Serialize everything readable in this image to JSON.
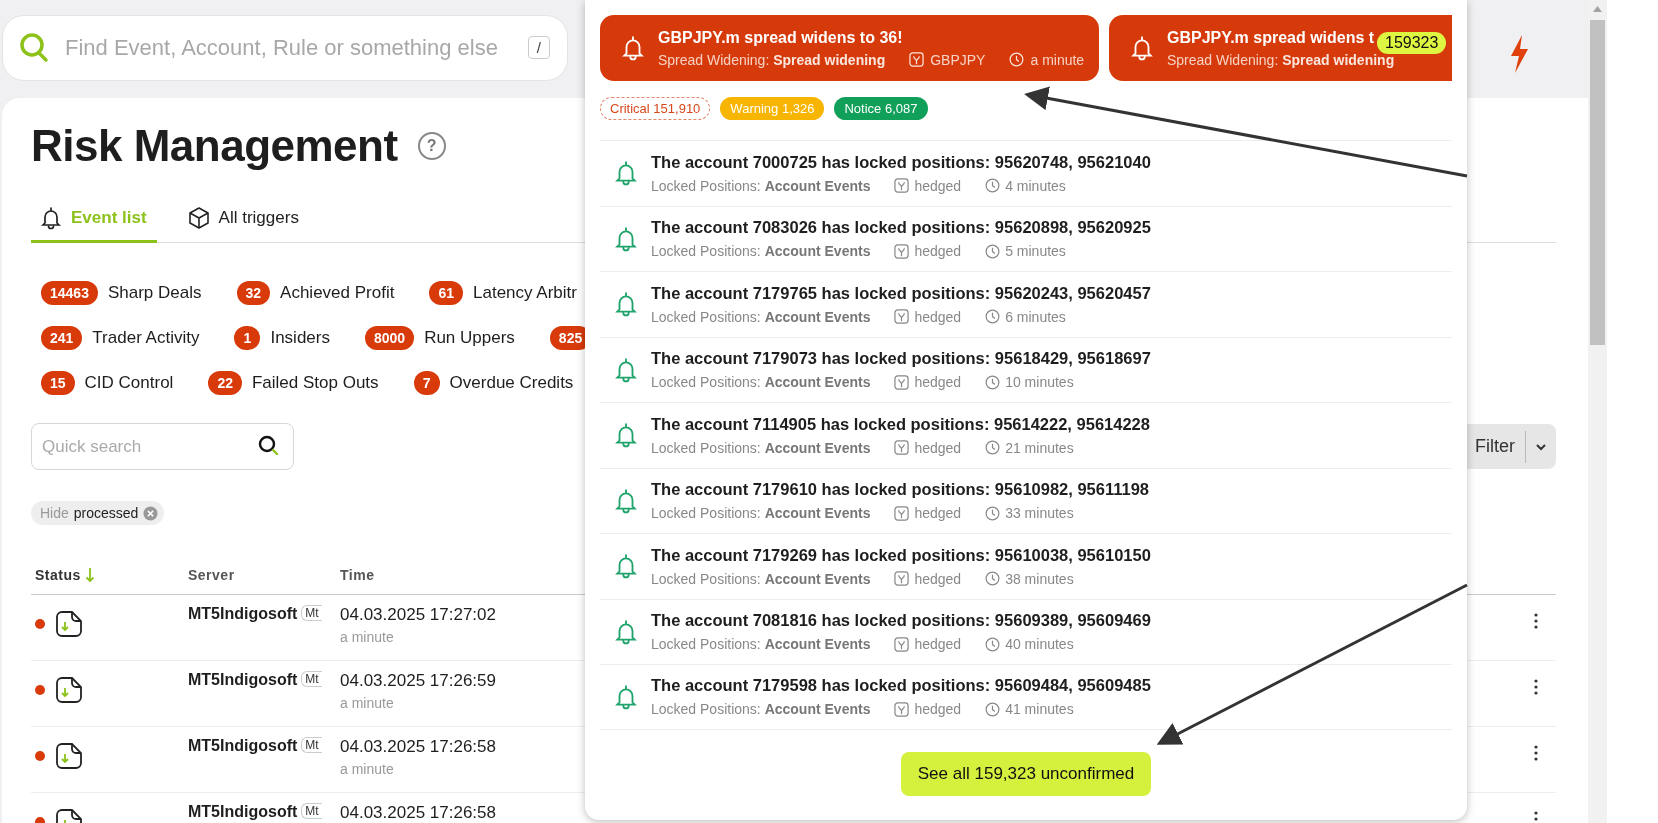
{
  "search": {
    "placeholder": "Find Event, Account, Rule or something else",
    "shortcut": "/"
  },
  "page": {
    "title": "Risk Management",
    "help": "?"
  },
  "tabs": [
    {
      "label": "Event list",
      "selected": true
    },
    {
      "label": "All triggers",
      "selected": false
    }
  ],
  "categories": [
    [
      {
        "count": "14463",
        "label": "Sharp Deals"
      },
      {
        "count": "32",
        "label": "Achieved Profit"
      },
      {
        "count": "61",
        "label": "Latency Arbitr"
      }
    ],
    [
      {
        "count": "241",
        "label": "Trader Activity"
      },
      {
        "count": "1",
        "label": "Insiders"
      },
      {
        "count": "8000",
        "label": "Run Uppers"
      },
      {
        "count": "825"
      }
    ],
    [
      {
        "count": "15",
        "label": "CID Control"
      },
      {
        "count": "22",
        "label": "Failed Stop Outs"
      },
      {
        "count": "7",
        "label": "Overdue Credits"
      }
    ]
  ],
  "quick_search": {
    "placeholder": "Quick search"
  },
  "filter_button": {
    "label": "Filter"
  },
  "active_filters": [
    {
      "label": "Hide",
      "value": "processed"
    }
  ],
  "table": {
    "columns": [
      {
        "label": "Status",
        "sorted": true
      },
      {
        "label": "Server",
        "sorted": false
      },
      {
        "label": "Time",
        "sorted": false
      }
    ],
    "rows": [
      {
        "color": "#d83a0a",
        "server": "MT5Indigosoft",
        "server_tag": "Mt",
        "time": "04.03.2025 17:27:02",
        "ago": "a minute"
      },
      {
        "color": "#d83a0a",
        "server": "MT5Indigosoft",
        "server_tag": "Mt",
        "time": "04.03.2025 17:26:59",
        "ago": "a minute"
      },
      {
        "color": "#d83a0a",
        "server": "MT5Indigosoft",
        "server_tag": "Mt",
        "time": "04.03.2025 17:26:58",
        "ago": "a minute"
      },
      {
        "color": "#d83a0a",
        "server": "MT5Indigosoft",
        "server_tag": "Mt",
        "time": "04.03.2025 17:26:58"
      }
    ]
  },
  "notifications": {
    "alerts": [
      {
        "title": "GBPJPY.m spread widens to 36!",
        "category": "Spread Widening:",
        "rule": "Spread widening",
        "symbol": "GBPJPY",
        "ago": "a minute"
      },
      {
        "title": "GBPJPY.m spread widens t",
        "category": "Spread Widening:",
        "rule": "Spread widening"
      }
    ],
    "unread_badge": "159323",
    "levels": [
      {
        "label": "Critical",
        "count": "151,910",
        "kind": "critical"
      },
      {
        "label": "Warning",
        "count": "1,326",
        "kind": "warning"
      },
      {
        "label": "Notice",
        "count": "6,087",
        "kind": "notice"
      }
    ],
    "events": [
      {
        "title": "The account 7000725 has locked positions: 95620748, 95621040",
        "category": "Locked Positions:",
        "group": "Account Events",
        "tag": "hedged",
        "ago": "4 minutes"
      },
      {
        "title": "The account 7083026 has locked positions: 95620898, 95620925",
        "category": "Locked Positions:",
        "group": "Account Events",
        "tag": "hedged",
        "ago": "5 minutes"
      },
      {
        "title": "The account 7179765 has locked positions: 95620243, 95620457",
        "category": "Locked Positions:",
        "group": "Account Events",
        "tag": "hedged",
        "ago": "6 minutes"
      },
      {
        "title": "The account 7179073 has locked positions: 95618429, 95618697",
        "category": "Locked Positions:",
        "group": "Account Events",
        "tag": "hedged",
        "ago": "10 minutes"
      },
      {
        "title": "The account 7114905 has locked positions: 95614222, 95614228",
        "category": "Locked Positions:",
        "group": "Account Events",
        "tag": "hedged",
        "ago": "21 minutes"
      },
      {
        "title": "The account 7179610 has locked positions: 95610982, 95611198",
        "category": "Locked Positions:",
        "group": "Account Events",
        "tag": "hedged",
        "ago": "33 minutes"
      },
      {
        "title": "The account 7179269 has locked positions: 95610038, 95610150",
        "category": "Locked Positions:",
        "group": "Account Events",
        "tag": "hedged",
        "ago": "38 minutes"
      },
      {
        "title": "The account 7081816 has locked positions: 95609389, 95609469",
        "category": "Locked Positions:",
        "group": "Account Events",
        "tag": "hedged",
        "ago": "40 minutes"
      },
      {
        "title": "The account 7179598 has locked positions: 95609484, 95609485",
        "category": "Locked Positions:",
        "group": "Account Events",
        "tag": "hedged",
        "ago": "41 minutes"
      }
    ],
    "see_all": "See all 159,323 unconfirmed"
  }
}
